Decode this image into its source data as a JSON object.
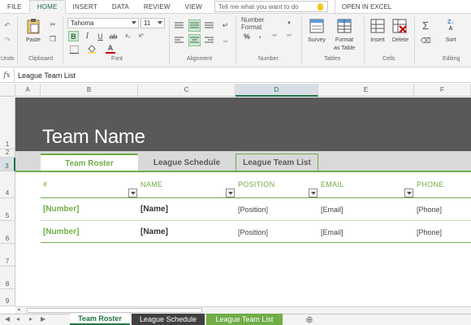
{
  "ribbon_tabs": [
    "FILE",
    "HOME",
    "INSERT",
    "DATA",
    "REVIEW",
    "VIEW"
  ],
  "tell_me_placeholder": "Tell me what you want to do",
  "open_in_excel": "OPEN IN EXCEL",
  "ribbon": {
    "undo_label": "Undo",
    "paste_label": "Paste",
    "clipboard_label": "Clipboard",
    "font_name": "Tahoma",
    "font_size": "11",
    "font_label": "Font",
    "alignment_label": "Alignment",
    "number_format": "Number Format",
    "number_label": "Number",
    "survey_label": "Survey",
    "format_table_label_1": "Format",
    "format_table_label_2": "as Table",
    "tables_label": "Tables",
    "insert_label": "Insert",
    "delete_label": "Delete",
    "cells_label": "Cells",
    "sort_label": "Sort",
    "editing_label": "Editing"
  },
  "formula_bar": {
    "fx": "fx",
    "value": "League Team List"
  },
  "columns": [
    "A",
    "B",
    "C",
    "D",
    "E",
    "F"
  ],
  "rows": [
    "1",
    "2",
    "3",
    "4",
    "5",
    "6",
    "7",
    "8",
    "9"
  ],
  "sheet": {
    "title": "Team Name",
    "tabs": [
      "Team Roster",
      "League Schedule",
      "League Team List"
    ],
    "headers": [
      "#",
      "NAME",
      "POSITION",
      "EMAIL",
      "PHONE"
    ],
    "rows": [
      [
        "[Number]",
        "[Name]",
        "[Position]",
        "[Email]",
        "[Phone]"
      ],
      [
        "[Number]",
        "[Name]",
        "[Position]",
        "[Email]",
        "[Phone]"
      ]
    ]
  },
  "sheet_tabs": [
    "Team Roster",
    "League Schedule",
    "League Team List"
  ],
  "colors": {
    "excel_green": "#217346",
    "accent_green": "#70ad47",
    "banner_gray": "#595959"
  }
}
